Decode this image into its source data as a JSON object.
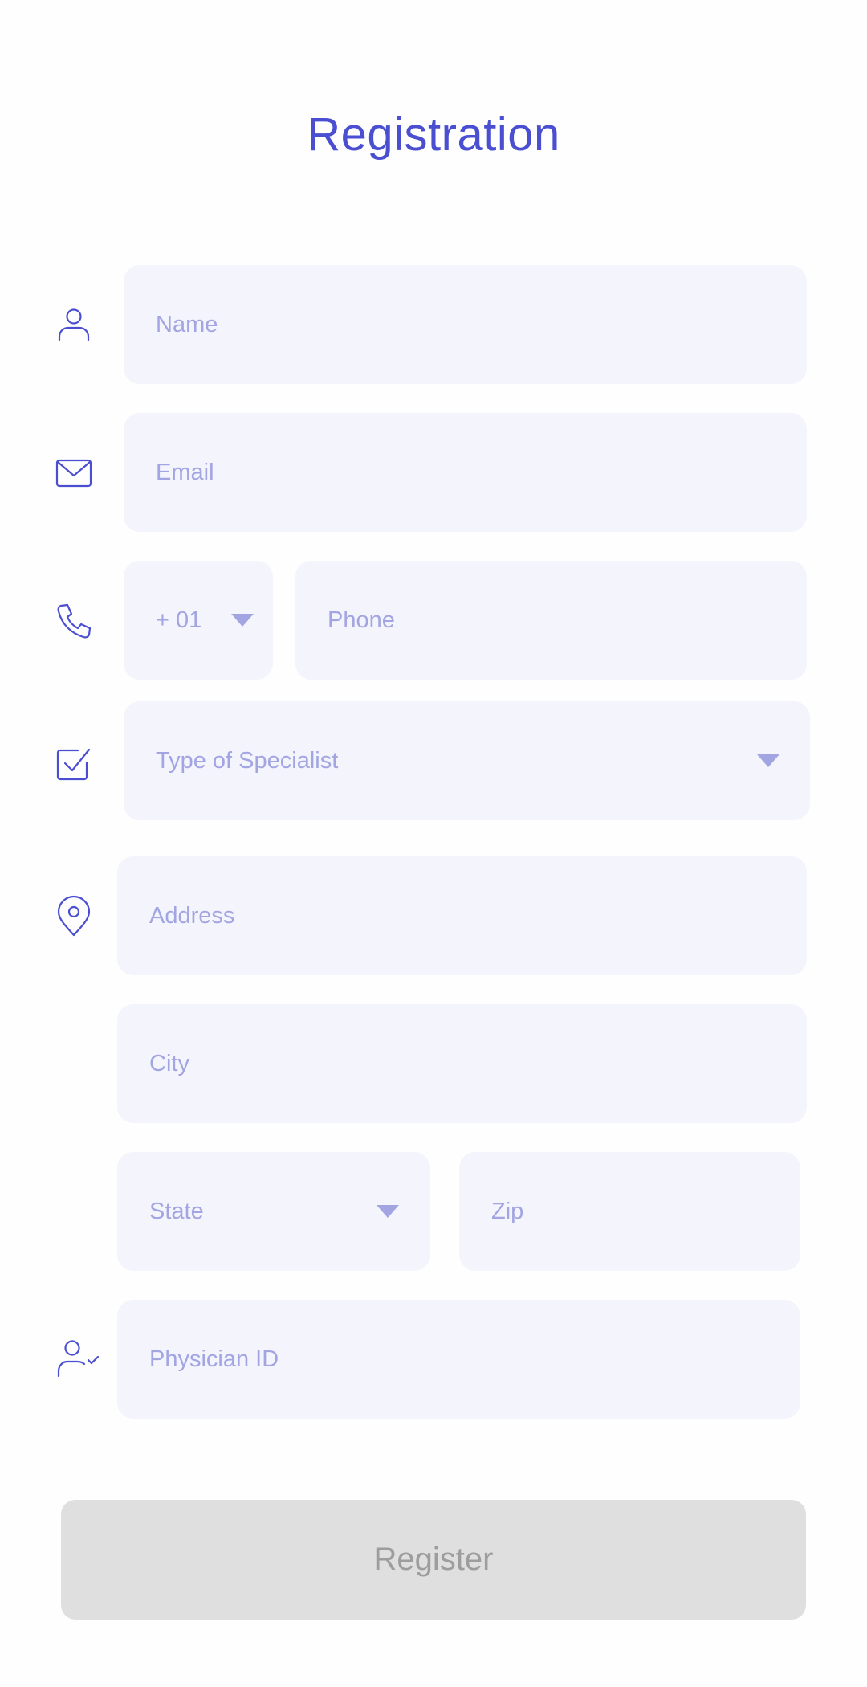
{
  "header": {
    "title": "Registration"
  },
  "form": {
    "name_placeholder": "Name",
    "email_placeholder": "Email",
    "country_code": "+ 01",
    "phone_placeholder": "Phone",
    "specialist_placeholder": "Type of Specialist",
    "address_placeholder": "Address",
    "city_placeholder": "City",
    "state_placeholder": "State",
    "zip_placeholder": "Zip",
    "physician_id_placeholder": "Physician ID"
  },
  "actions": {
    "register_label": "Register"
  },
  "icons": {
    "name": "person-icon",
    "email": "mail-icon",
    "phone": "phone-icon",
    "specialist": "checkbox-icon",
    "address": "location-pin-icon",
    "physician": "person-check-icon"
  },
  "colors": {
    "accent": "#4a4ed1",
    "field_background": "#f3f4fc",
    "placeholder": "#a2a5e2",
    "button_disabled_background": "#dfdfdf",
    "button_disabled_text": "#9d9d9d"
  }
}
